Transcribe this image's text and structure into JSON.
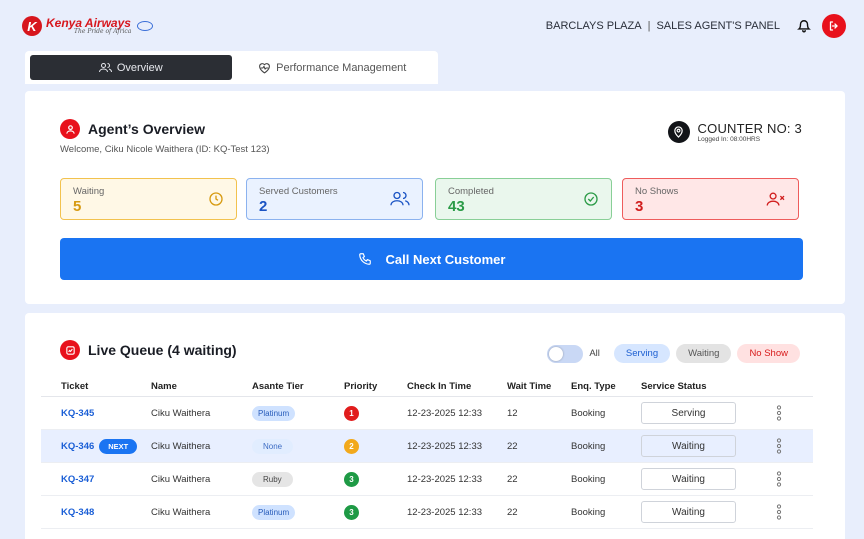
{
  "brand": {
    "name": "Kenya Airways",
    "tagline": "The Pride of Africa",
    "color": "#d7161d"
  },
  "header": {
    "location": "BARCLAYS PLAZA",
    "separator": "|",
    "panel": "SALES AGENT'S PANEL",
    "icons": [
      "bell-icon",
      "logout-icon"
    ]
  },
  "tabs": [
    {
      "label": "Overview",
      "icon": "users-icon",
      "active": true
    },
    {
      "label": "Performance Management",
      "icon": "heart-pulse-icon",
      "active": false
    }
  ],
  "overview": {
    "title": "Agent’s Overview",
    "welcome": "Welcome, Ciku Nicole Waithera (ID: KQ-Test 123)",
    "counter": "COUNTER NO: 3",
    "logged_in": "Logged In: 08:00HRS",
    "stats": {
      "waiting": {
        "label": "Waiting",
        "value": "5",
        "icon": "clock-icon"
      },
      "served": {
        "label": "Served Customers",
        "value": "2",
        "icon": "users-icon"
      },
      "completed": {
        "label": "Completed",
        "value": "43",
        "icon": "check-circle-icon"
      },
      "no_shows": {
        "label": "No Shows",
        "value": "3",
        "icon": "user-x-icon"
      }
    },
    "call_button": "Call Next Customer"
  },
  "queue": {
    "title": "Live Queue (4 waiting)",
    "filter_all": "All",
    "filters": [
      "Serving",
      "Waiting",
      "No Show"
    ],
    "columns": [
      "Ticket",
      "Name",
      "Asante Tier",
      "Priority",
      "Check In Time",
      "Wait Time",
      "Enq. Type",
      "Service Status"
    ],
    "next_badge": "NEXT",
    "rows": [
      {
        "ticket": "KQ-345",
        "name": "Ciku Waithera",
        "tier": "Platinum",
        "priority": "1",
        "priority_color": "#e11d1d",
        "check_in": "12-23-2025 12:33",
        "wait": "12",
        "enq": "Booking",
        "status": "Serving"
      },
      {
        "ticket": "KQ-346",
        "name": "Ciku Waithera",
        "tier": "None",
        "priority": "2",
        "priority_color": "#f2a91c",
        "check_in": "12-23-2025 12:33",
        "wait": "22",
        "enq": "Booking",
        "status": "Waiting"
      },
      {
        "ticket": "KQ-347",
        "name": "Ciku Waithera",
        "tier": "Ruby",
        "priority": "3",
        "priority_color": "#1e9a45",
        "check_in": "12-23-2025 12:33",
        "wait": "22",
        "enq": "Booking",
        "status": "Waiting"
      },
      {
        "ticket": "KQ-348",
        "name": "Ciku Waithera",
        "tier": "Platinum",
        "priority": "3",
        "priority_color": "#1e9a45",
        "check_in": "12-23-2025 12:33",
        "wait": "22",
        "enq": "Booking",
        "status": "Waiting"
      }
    ]
  }
}
